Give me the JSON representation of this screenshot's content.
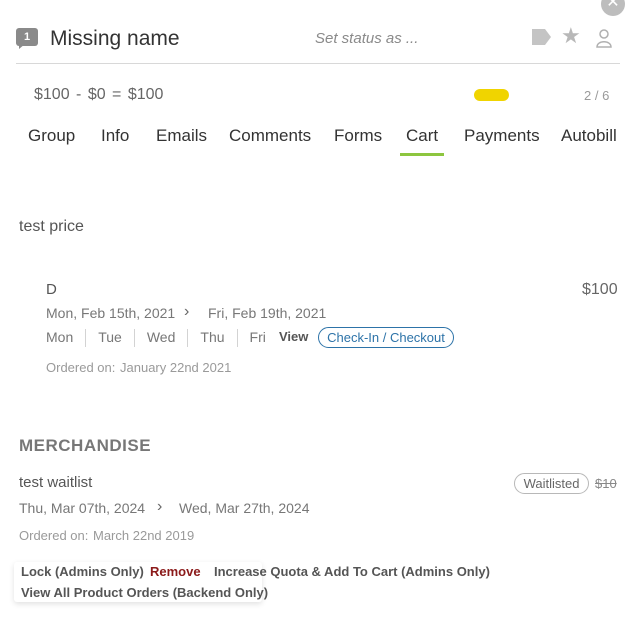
{
  "header": {
    "count": "1",
    "name": "Missing name",
    "status_placeholder": "Set status as ..."
  },
  "summary": {
    "pricing": "$100  -  $0  =  $100",
    "pager": "2 / 6"
  },
  "tabs": [
    {
      "label": "Group"
    },
    {
      "label": "Info"
    },
    {
      "label": "Emails"
    },
    {
      "label": "Comments"
    },
    {
      "label": "Forms"
    },
    {
      "label": "Cart",
      "active": true
    },
    {
      "label": "Payments"
    },
    {
      "label": "Autobill"
    }
  ],
  "cart": {
    "section_title": "test price",
    "item": {
      "name": "D",
      "price": "$100",
      "start_date": "Mon, Feb 15th, 2021",
      "end_date": "Fri, Feb 19th, 2021",
      "days": [
        "Mon",
        "Tue",
        "Wed",
        "Thu",
        "Fri"
      ],
      "view_label": "View",
      "checkin_label": "Check-In / Checkout",
      "ordered_label": "Ordered on:",
      "ordered_date": "January 22nd 2021"
    }
  },
  "merchandise": {
    "title": "MERCHANDISE",
    "item": {
      "name": "test waitlist",
      "badge": "Waitlisted",
      "price": "$10",
      "start_date": "Thu, Mar 07th, 2024",
      "end_date": "Wed, Mar 27th, 2024",
      "ordered_label": "Ordered on:",
      "ordered_date": "March 22nd 2019"
    },
    "actions": {
      "lock": "Lock (Admins Only)",
      "remove": "Remove",
      "increase": "Increase Quota & Add To Cart (Admins Only)",
      "view_all": "View All Product Orders (Backend Only)"
    }
  },
  "colors": {
    "accent_green": "#8dc63f",
    "pill_yellow": "#f0d400",
    "link_blue": "#2d73a8",
    "remove_red": "#8b1a1a"
  },
  "icons": [
    "close-icon",
    "count-badge-icon",
    "tag-icon",
    "star-icon",
    "user-icon",
    "chevron-right-icon"
  ]
}
